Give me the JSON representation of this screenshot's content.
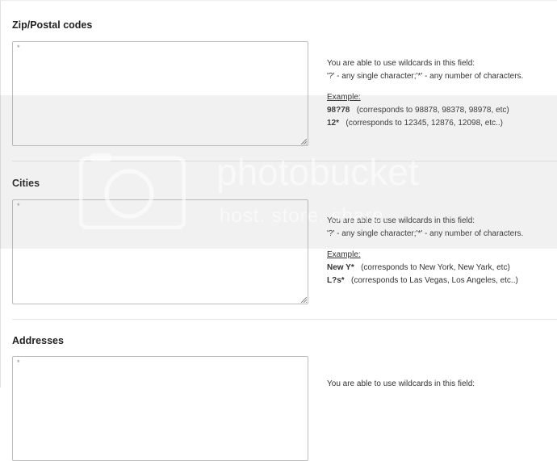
{
  "sections": [
    {
      "title": "Zip/Postal codes",
      "placeholder": "*",
      "help_line1": "You are able to use wildcards in this field:",
      "help_line2": "'?' - any single character;'*' - any number of characters.",
      "example_label": "Example:",
      "examples": [
        {
          "code": "98?78",
          "desc": "(corresponds to 98878, 98378, 98978, etc)"
        },
        {
          "code": "12*",
          "desc": "(corresponds to 12345, 12876, 12098, etc..)"
        }
      ]
    },
    {
      "title": "Cities",
      "placeholder": "*",
      "help_line1": "You are able to use wildcards in this field:",
      "help_line2": "'?' - any single character;'*' - any number of characters.",
      "example_label": "Example:",
      "examples": [
        {
          "code": "New Y*",
          "desc": "(corresponds to New York, New Yark, etc)"
        },
        {
          "code": "L?s*",
          "desc": "(corresponds to Las Vegas, Los Angeles, etc..)"
        }
      ]
    },
    {
      "title": "Addresses",
      "placeholder": "*",
      "help_line1": "You are able to use wildcards in this field:"
    }
  ],
  "watermark": {
    "line1": "photobucket",
    "line2": "host. store. share."
  }
}
